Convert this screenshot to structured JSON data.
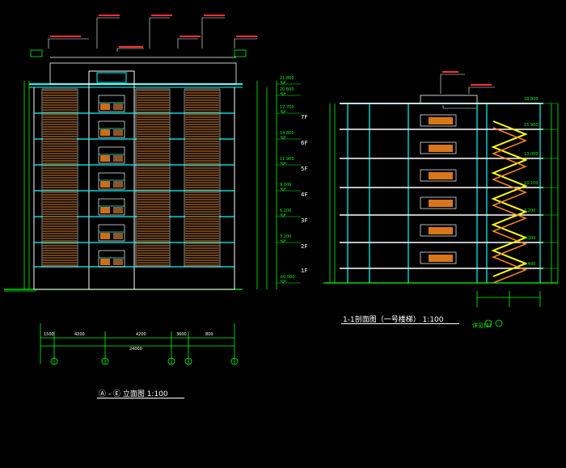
{
  "drawing": {
    "elevation_title": "Ⓐ - Ⓔ 立面图   1:100",
    "section_title": "1-1剖面图（一号楼梯）  1:100",
    "section_scale_label": "1:100",
    "elevation_floor_labels": [
      "7F",
      "6F",
      "5F",
      "4F",
      "3F",
      "2F",
      "1F"
    ],
    "elevation_levels": [
      "21.800",
      "20.600",
      "17.700",
      "14.800",
      "11.900",
      "9.000",
      "6.100",
      "3.200",
      "±0.000"
    ],
    "section_levels": [
      "18.800",
      "15.900",
      "13.000",
      "10.100",
      "7.200",
      "4.300",
      "1.400"
    ],
    "overall_dim": "24000",
    "bay_dims": [
      "1500",
      "4200",
      "4200",
      "3600",
      "800"
    ],
    "axis_labels": [
      "1",
      "2",
      "3",
      "4",
      "5"
    ],
    "section_detail_label": "详见(1)",
    "colors": {
      "background": "#000000",
      "green": "#00ff00",
      "cyan": "#00ffff",
      "yellow": "#ffff00",
      "orange": "#ff8a1e",
      "white": "#ffffff",
      "wood": "#b06a2a"
    }
  }
}
